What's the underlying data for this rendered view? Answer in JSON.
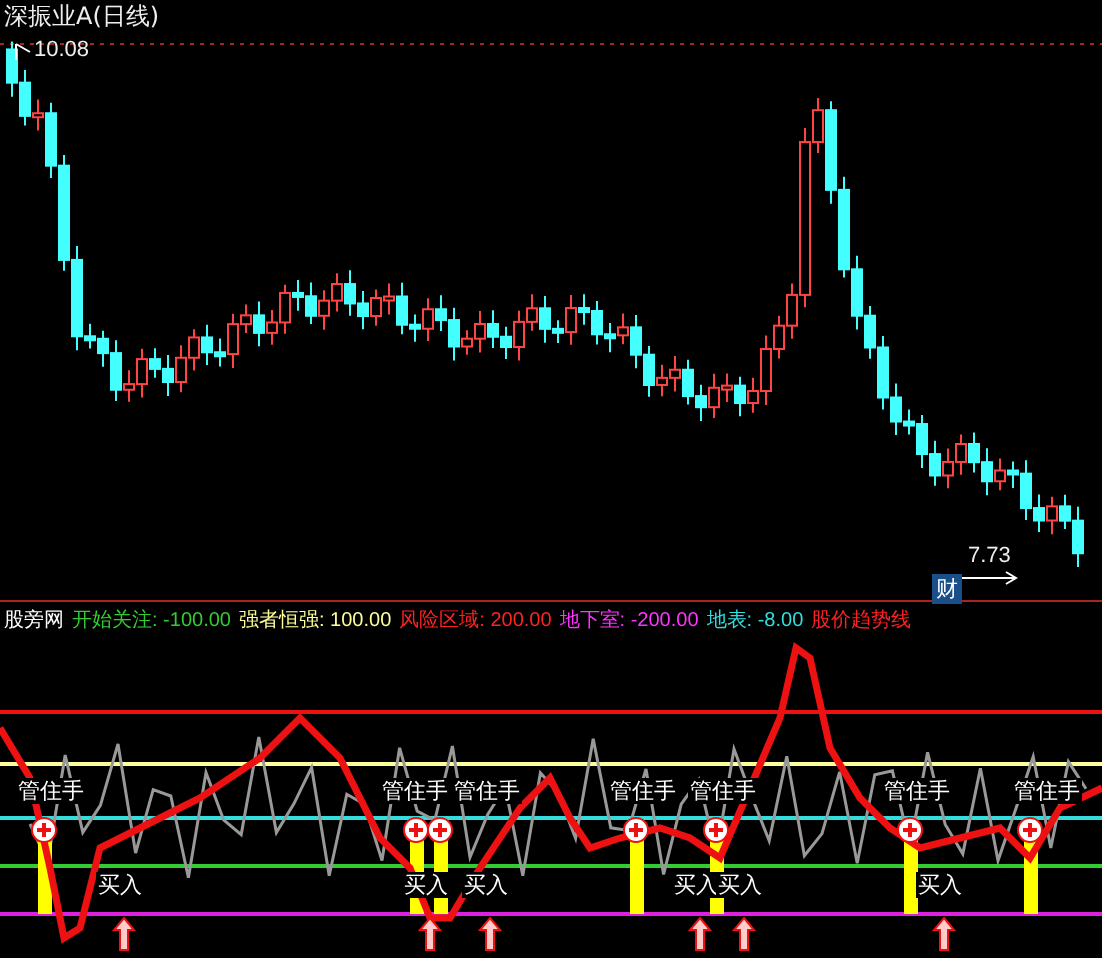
{
  "title": "深振业A(日线)",
  "high_label": "10.08",
  "low_label": "7.73",
  "badge": "财",
  "legend": [
    {
      "label": "股旁网",
      "color": "#ffffff"
    },
    {
      "label": "开始关注: -100.00",
      "color": "#33cc33"
    },
    {
      "label": "强者恒强: 100.00",
      "color": "#ffff99"
    },
    {
      "label": "风险区域: 200.00",
      "color": "#ff2222"
    },
    {
      "label": "地下室: -200.00",
      "color": "#ff33ff"
    },
    {
      "label": "地表: -8.00",
      "color": "#33dddd"
    },
    {
      "label": "股价趋势线",
      "color": "#ff2222"
    }
  ],
  "signals": [
    {
      "kind": "hold",
      "text": "管住手"
    },
    {
      "kind": "hold",
      "text": "管住手"
    },
    {
      "kind": "hold",
      "text": "管住手"
    },
    {
      "kind": "hold",
      "text": "管住手"
    },
    {
      "kind": "hold",
      "text": "管住手"
    },
    {
      "kind": "hold",
      "text": "管住手"
    },
    {
      "kind": "hold",
      "text": "管住手"
    },
    {
      "kind": "buy",
      "text": "买入"
    },
    {
      "kind": "buy",
      "text": "买入"
    },
    {
      "kind": "buy",
      "text": "买入"
    },
    {
      "kind": "buy",
      "text": "买入"
    },
    {
      "kind": "buy",
      "text": "买入"
    },
    {
      "kind": "buy",
      "text": "买入"
    }
  ]
}
